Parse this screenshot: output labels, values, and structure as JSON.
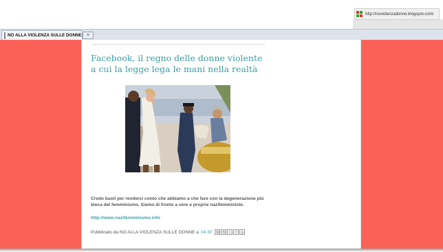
{
  "browser": {
    "url": "http://noviolenzadonne.blogspot.com/",
    "tab_title": "NO ALLA VIOLENZA SULLE DONNE",
    "new_tab_symbol": "+",
    "tab_close_symbol": "×"
  },
  "post": {
    "title": "Facebook, il regno delle donne violente a cui la legge lega le mani nella realtà",
    "image_icon": "photo-police-women-beach",
    "body": "Credo basti per renderci conto che abbiamo a che fare con la degenerazione più bieca del femminismo. Siamo di fronte a vere e proprie nazifemministe.",
    "link": "http://www.nazifemminismo.info",
    "footer_prefix": "Pubblicato da",
    "author": "NO ALLA VIOLENZA SULLE DONNE",
    "at_word": "a",
    "time": "04:30",
    "share_buttons": [
      "M",
      "B",
      "t",
      "f",
      "p"
    ]
  },
  "colors": {
    "page_background": "#fb6157",
    "title_link": "#3d9ea3",
    "text": "#555555"
  }
}
